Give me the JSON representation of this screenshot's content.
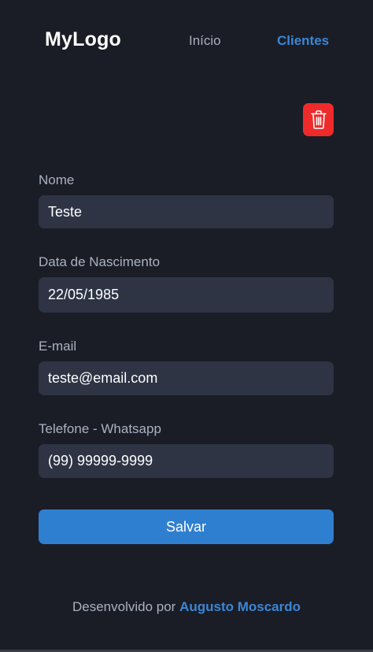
{
  "header": {
    "logo": "MyLogo",
    "nav": {
      "inicio": "Início",
      "clientes": "Clientes"
    }
  },
  "actions": {
    "delete_icon": "trash-icon"
  },
  "form": {
    "nome": {
      "label": "Nome",
      "value": "Teste"
    },
    "nascimento": {
      "label": "Data de Nascimento",
      "value": "22/05/1985"
    },
    "email": {
      "label": "E-mail",
      "value": "teste@email.com"
    },
    "telefone": {
      "label": "Telefone - Whatsapp",
      "value": "(99) 99999-9999"
    },
    "save_label": "Salvar"
  },
  "footer": {
    "prefix": "Desenvolvido por",
    "author": "Augusto Moscardo"
  },
  "colors": {
    "background": "#1a1d26",
    "input_bg": "#2e3444",
    "accent": "#2f7fd0",
    "danger": "#ee2a2a",
    "label": "#aab1c0"
  }
}
